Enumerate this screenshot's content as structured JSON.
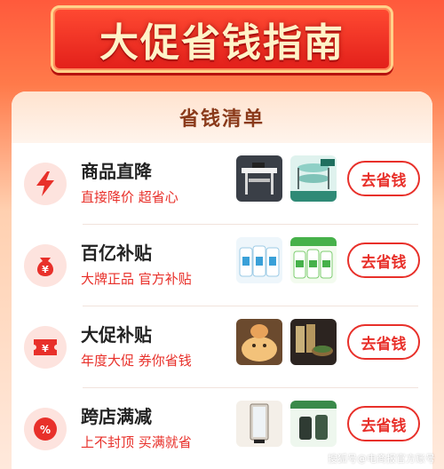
{
  "banner": {
    "title": "大促省钱指南"
  },
  "card": {
    "title": "省钱清单"
  },
  "rows": [
    {
      "title": "商品直降",
      "subtitle": "直接降价 超省心",
      "button": "去省钱",
      "icon": "lightning-icon"
    },
    {
      "title": "百亿补贴",
      "subtitle": "大牌正品 官方补贴",
      "button": "去省钱",
      "icon": "money-bag-icon"
    },
    {
      "title": "大促补贴",
      "subtitle": "年度大促 券你省钱",
      "button": "去省钱",
      "icon": "coupon-icon"
    },
    {
      "title": "跨店满减",
      "subtitle": "上不封顶 买满就省",
      "button": "去省钱",
      "icon": "discount-tag-icon"
    }
  ],
  "watermark": "搜狐号@电商报官方账号",
  "colors": {
    "accent": "#e8302a",
    "banner_text": "#fff3c8",
    "title_brown": "#8a3a1a"
  }
}
